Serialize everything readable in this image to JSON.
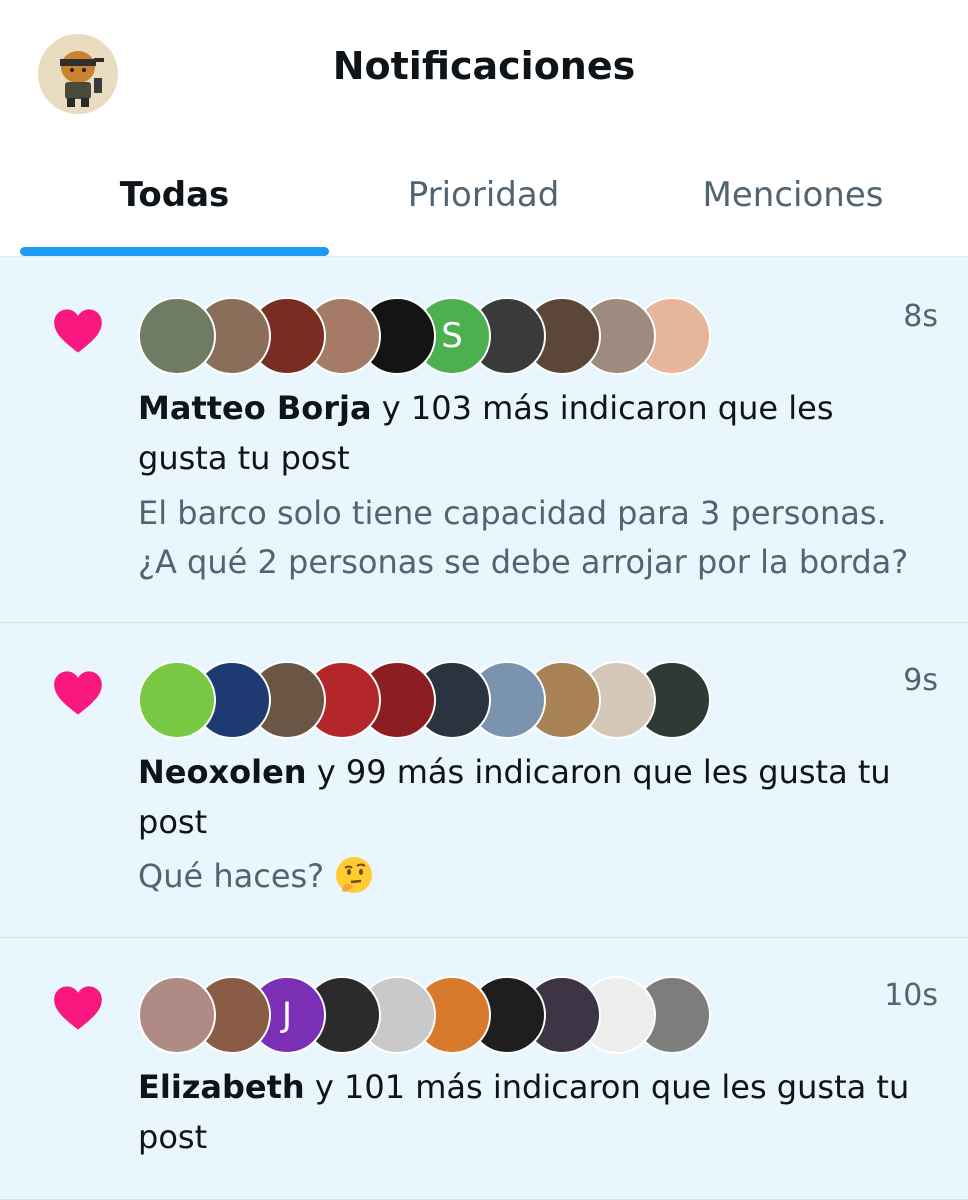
{
  "header": {
    "title": "Notificaciones",
    "tabs": [
      {
        "label": "Todas",
        "active": true
      },
      {
        "label": "Prioridad",
        "active": false
      },
      {
        "label": "Menciones",
        "active": false
      }
    ],
    "accent_color": "#1d9bf0"
  },
  "notifications": [
    {
      "icon": "heart-icon",
      "time": "8s",
      "user": "Matteo Borja",
      "action_line1": " y 103 más indicaron que les",
      "action_line2": "gusta tu post",
      "snippet_line1": "El barco solo tiene capacidad para 3 personas.",
      "snippet_line2": "¿A qué 2 personas se debe arrojar por la borda?",
      "avatar_letters": [
        "",
        "",
        "",
        "",
        "",
        "S",
        "",
        "",
        "",
        ""
      ],
      "avatar_colors": [
        "#6f7b63",
        "#8a6e5a",
        "#7a2c22",
        "#a57b68",
        "#141414",
        "#4caf50",
        "#3a3a3a",
        "#5b4638",
        "#9d8b80",
        "#e5b79a"
      ]
    },
    {
      "icon": "heart-icon",
      "time": "9s",
      "user": "Neoxolen",
      "action_line1": " y 99 más indicaron que les gusta tu",
      "action_line2": "post",
      "snippet_text": "Qué haces? ",
      "snippet_emoji": "thinking-face-emoji",
      "avatar_letters": [
        "",
        "",
        "",
        "",
        "",
        "",
        "",
        "",
        "",
        ""
      ],
      "avatar_colors": [
        "#79c843",
        "#1d3a72",
        "#6b5545",
        "#b3262a",
        "#8c1e22",
        "#2b3340",
        "#7a94b0",
        "#a88155",
        "#d4c7b8",
        "#2f3a34"
      ]
    },
    {
      "icon": "heart-icon",
      "time": "10s",
      "user": "Elizabeth",
      "action_line1": " y 101 más indicaron que les gusta tu",
      "action_line2": "post",
      "avatar_letters": [
        "",
        "",
        "J",
        "",
        "",
        "",
        "",
        "",
        "",
        ""
      ],
      "avatar_colors": [
        "#b08b86",
        "#8a5b45",
        "#7b2fb5",
        "#2b2b2b",
        "#c9c9c9",
        "#d87a2b",
        "#1e1e1e",
        "#3d3446",
        "#ededed",
        "#7d7d7d"
      ]
    }
  ],
  "colors": {
    "heart": "#f91880",
    "feed_bg": "#eaf6fd",
    "secondary_text": "#536471"
  }
}
